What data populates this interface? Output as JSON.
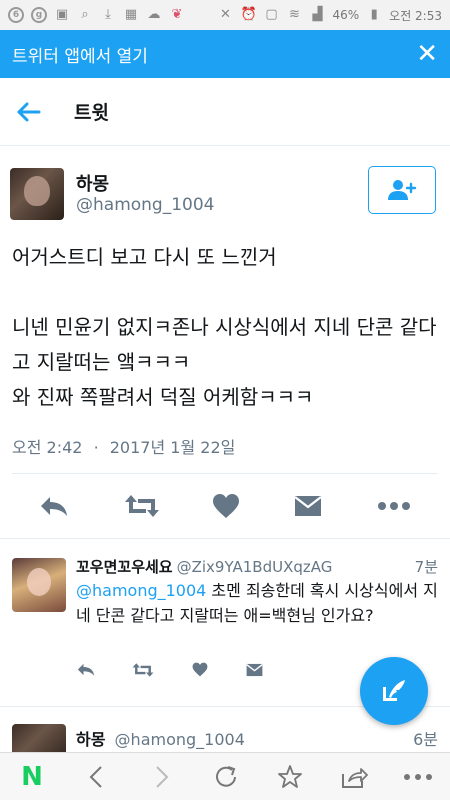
{
  "status_bar": {
    "battery": "46%",
    "time": "오전 2:53"
  },
  "banner": {
    "text": "트위터 앱에서 열기",
    "close_glyph": "✕"
  },
  "nav": {
    "title": "트윗"
  },
  "tweet": {
    "name": "하몽",
    "handle": "@hamong_1004",
    "lines": [
      "어거스트디 보고 다시 또 느낀거",
      "",
      "니넨 민윤기 없지ㅋ존나 시상식에서 지네 단콘 같다고 지랄떠는 앸ㅋㅋㅋ",
      "와 진짜 쪽팔려서 덕질 어케함ㅋㅋㅋ"
    ],
    "time": "오전 2:42",
    "dot": "·",
    "date": "2017년 1월 22일"
  },
  "reply": {
    "name": "꼬우면꼬우세요",
    "handle": "@Zix9YA1BdUXqzAG",
    "time": "7분",
    "mention": "@hamong_1004",
    "text": " 초멘 죄송한데 혹시 시상식에서 지네 단콘 같다고 지랄떠는 애=백현님 인가요?"
  },
  "reply2": {
    "name": "하몽",
    "handle": "@hamong_1004",
    "time": "6분"
  },
  "colors": {
    "accent": "#1da1f2",
    "naver_green": "#19ce60",
    "icon_gray": "#657786"
  },
  "icons": [
    "back-arrow",
    "follow-add-user",
    "reply",
    "retweet",
    "like-heart",
    "direct-message",
    "more",
    "compose",
    "naver-logo",
    "browser-back",
    "browser-forward",
    "refresh",
    "bookmark-star",
    "share",
    "browser-menu"
  ]
}
